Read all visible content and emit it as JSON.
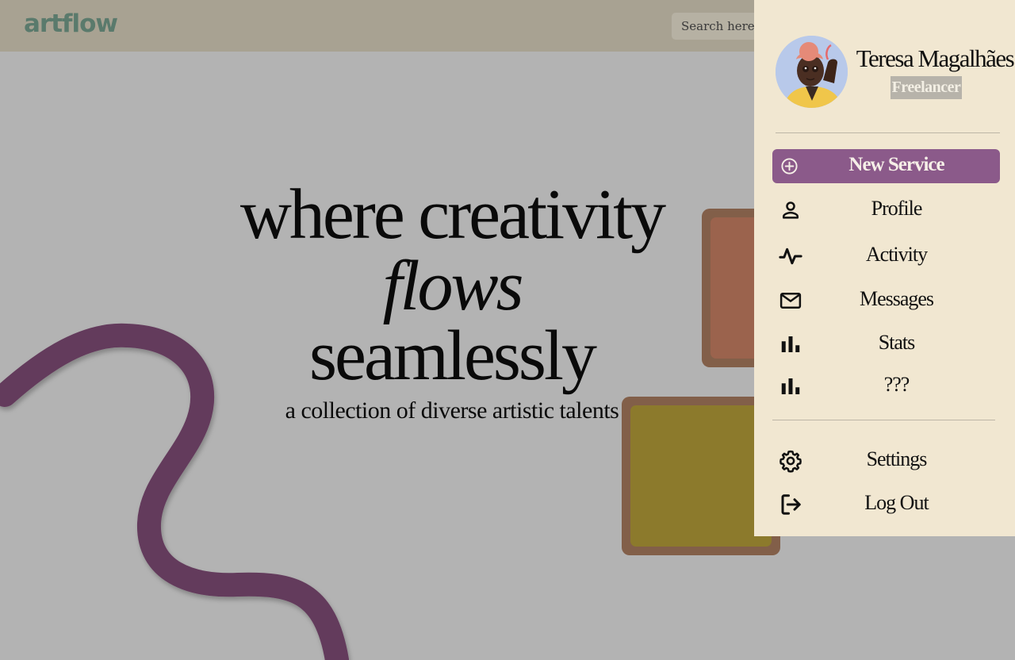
{
  "header": {
    "logo": "artflow",
    "search_placeholder": "Search here..."
  },
  "hero": {
    "line1": "where creativity",
    "line2_italic": "flows",
    "line2_rest": " seamlessly",
    "subtitle": "a collection of diverse artistic talents"
  },
  "user": {
    "name": "Teresa Magalhães",
    "role": "Freelancer"
  },
  "menu": {
    "new_service": "New Service",
    "items": [
      {
        "label": "Profile",
        "icon": "person-icon"
      },
      {
        "label": "Activity",
        "icon": "activity-icon"
      },
      {
        "label": "Messages",
        "icon": "mail-icon"
      },
      {
        "label": "Stats",
        "icon": "bar-chart-icon"
      },
      {
        "label": "???",
        "icon": "bar-chart-icon"
      }
    ],
    "bottom": [
      {
        "label": "Settings",
        "icon": "gear-icon"
      },
      {
        "label": "Log Out",
        "icon": "logout-icon"
      }
    ]
  },
  "colors": {
    "accent": "#8b5a8a",
    "panel": "#f1e7d1",
    "header": "#a8a292",
    "background": "#b3b3b3",
    "squiggle": "#643a5c"
  }
}
